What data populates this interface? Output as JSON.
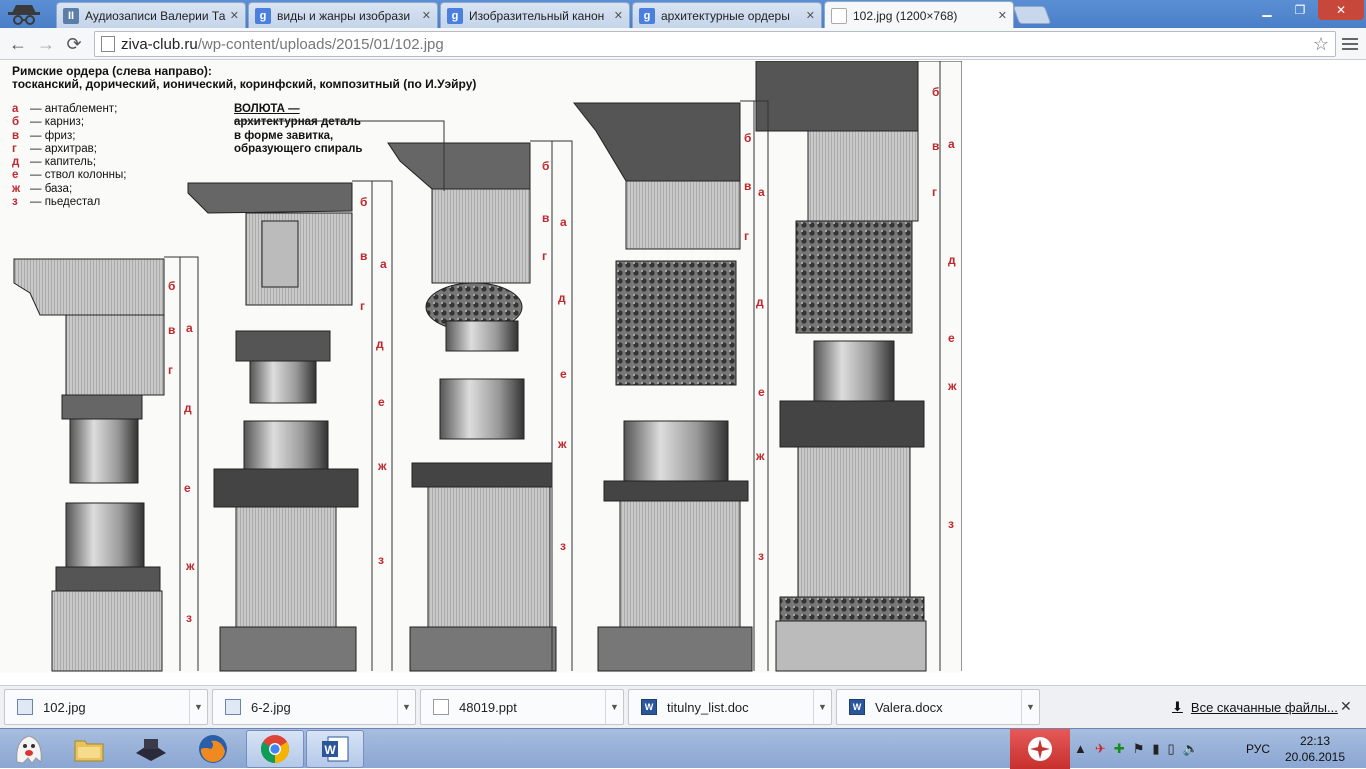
{
  "tabs": [
    {
      "label": "Аудиозаписи Валерии Та",
      "icon": "vk-icon",
      "active": false
    },
    {
      "label": "виды и жанры изобрази",
      "icon": "google-icon",
      "active": false
    },
    {
      "label": "Изобразительный канон",
      "icon": "google-icon",
      "active": false
    },
    {
      "label": "архитектурные ордеры",
      "icon": "google-icon",
      "active": false
    },
    {
      "label": "102.jpg (1200×768)",
      "icon": "document-icon",
      "active": true
    }
  ],
  "address": {
    "host": "ziva-club.ru",
    "path": "/wp-content/uploads/2015/01/102.jpg"
  },
  "image": {
    "title_line1": "Римские ордера (слева направо):",
    "title_line2": "тосканский, дорический, ионический, коринфский, композитный (по И.Уэйру)",
    "legend": [
      {
        "key": "а",
        "text": "— антаблемент;"
      },
      {
        "key": "б",
        "text": "— карниз;"
      },
      {
        "key": "в",
        "text": "— фриз;"
      },
      {
        "key": "г",
        "text": "— архитрав;"
      },
      {
        "key": "д",
        "text": "— капитель;"
      },
      {
        "key": "е",
        "text": "— ствол колонны;"
      },
      {
        "key": "ж",
        "text": "— база;"
      },
      {
        "key": "з",
        "text": "— пьедестал"
      }
    ],
    "volute": {
      "heading": "ВОЛЮТА —",
      "lines": [
        "архитектурная деталь",
        "в форме завитка,",
        "образующего спираль"
      ]
    },
    "labels": {
      "a": "а",
      "b": "б",
      "v": "в",
      "g": "г",
      "d": "д",
      "e": "е",
      "zh": "ж",
      "z": "з"
    }
  },
  "downloads": [
    {
      "name": "102.jpg",
      "icon": "image-file-icon"
    },
    {
      "name": "6-2.jpg",
      "icon": "image-file-icon"
    },
    {
      "name": "48019.ppt",
      "icon": "blank-file-icon"
    },
    {
      "name": "titulny_list.doc",
      "icon": "word-file-icon"
    },
    {
      "name": "Valera.docx",
      "icon": "word-file-icon"
    }
  ],
  "all_downloads_label": "Все скачанные файлы...",
  "taskbar": {
    "language": "РУС",
    "time": "22:13",
    "date": "20.06.2015"
  }
}
